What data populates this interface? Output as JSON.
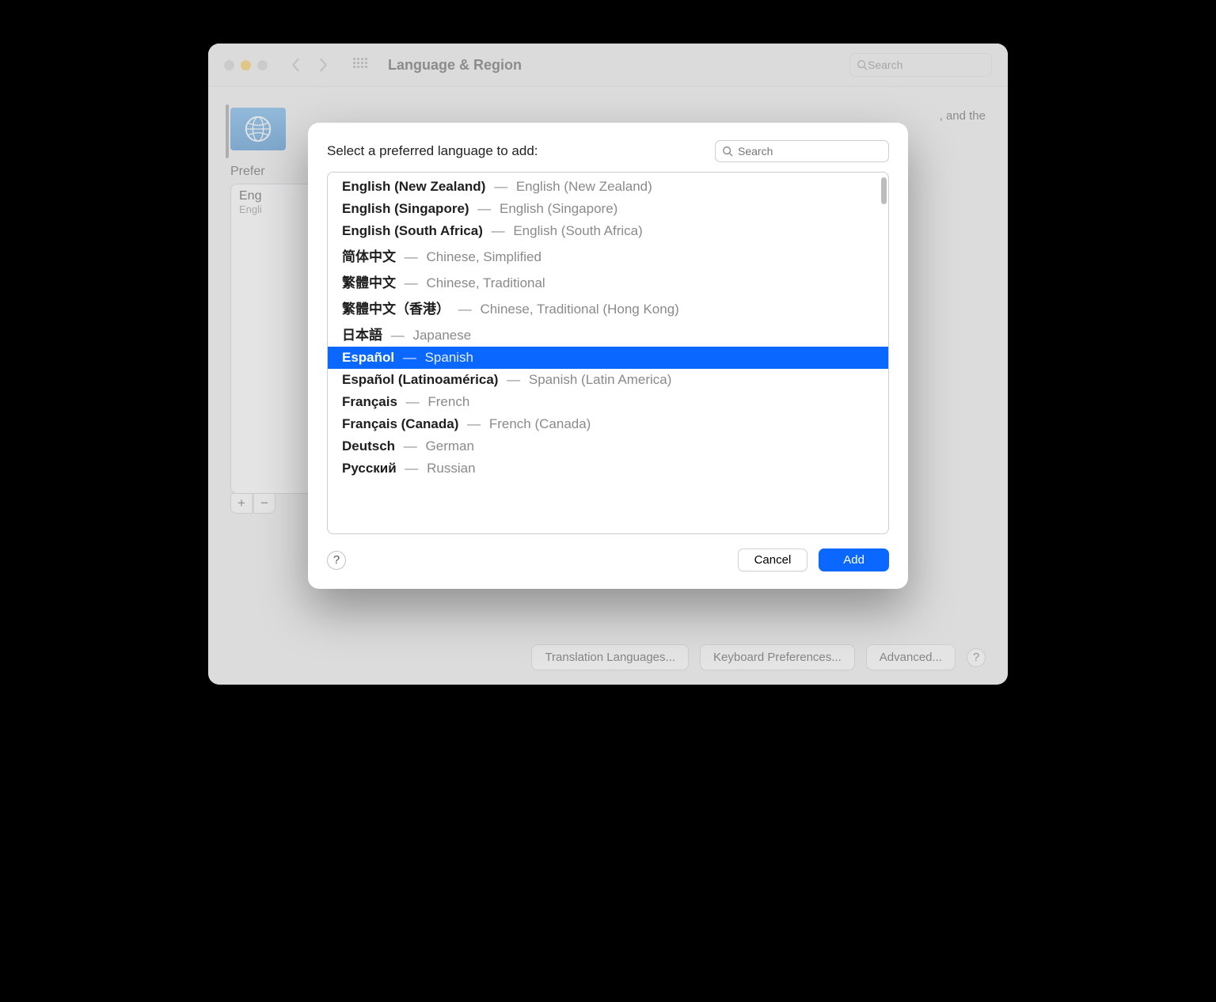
{
  "window": {
    "title": "Language & Region",
    "search_placeholder": "Search"
  },
  "background": {
    "description": ", and the",
    "preferred_label": "Prefer",
    "entry_primary": "Eng",
    "entry_sub": "Engli",
    "buttons": {
      "translation": "Translation Languages...",
      "keyboard": "Keyboard Preferences...",
      "advanced": "Advanced..."
    }
  },
  "sheet": {
    "title": "Select a preferred language to add:",
    "search_placeholder": "Search",
    "languages": [
      {
        "native": "English (New Zealand)",
        "english": "English (New Zealand)",
        "selected": false
      },
      {
        "native": "English (Singapore)",
        "english": "English (Singapore)",
        "selected": false
      },
      {
        "native": "English (South Africa)",
        "english": "English (South Africa)",
        "selected": false
      },
      {
        "native": "简体中文",
        "english": "Chinese, Simplified",
        "selected": false
      },
      {
        "native": "繁體中文",
        "english": "Chinese, Traditional",
        "selected": false
      },
      {
        "native": "繁體中文（香港）",
        "english": "Chinese, Traditional (Hong Kong)",
        "selected": false
      },
      {
        "native": "日本語",
        "english": "Japanese",
        "selected": false
      },
      {
        "native": "Español",
        "english": "Spanish",
        "selected": true
      },
      {
        "native": "Español (Latinoamérica)",
        "english": "Spanish (Latin America)",
        "selected": false
      },
      {
        "native": "Français",
        "english": "French",
        "selected": false
      },
      {
        "native": "Français (Canada)",
        "english": "French (Canada)",
        "selected": false
      },
      {
        "native": "Deutsch",
        "english": "German",
        "selected": false
      },
      {
        "native": "Русский",
        "english": "Russian",
        "selected": false
      }
    ],
    "cancel": "Cancel",
    "add": "Add"
  }
}
